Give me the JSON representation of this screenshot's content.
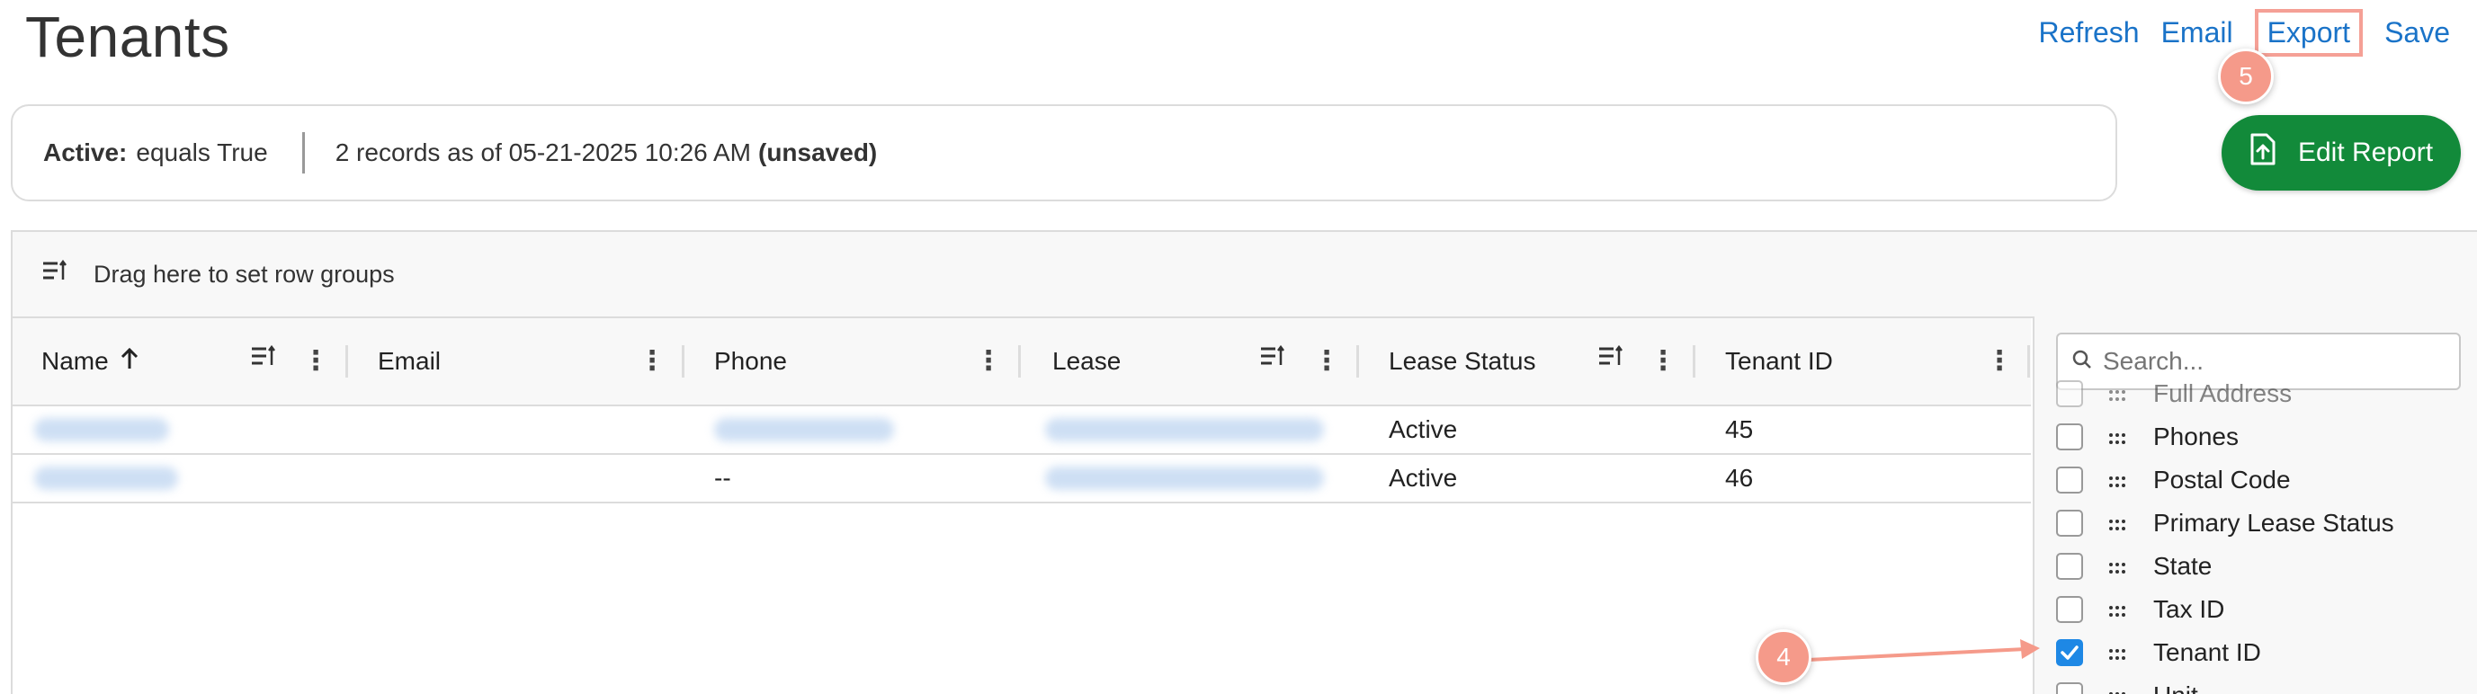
{
  "page": {
    "title": "Tenants"
  },
  "top_actions": {
    "refresh": "Refresh",
    "email": "Email",
    "export": "Export",
    "save": "Save"
  },
  "annotations": {
    "badge_export": "5",
    "badge_tenant_id": "4"
  },
  "filter": {
    "label": "Active:",
    "value": "equals True",
    "summary": "2 records as of 05-21-2025 10:26 AM",
    "status": "(unsaved)"
  },
  "edit_report": {
    "label": "Edit Report"
  },
  "group_bar": {
    "text": "Drag here to set row groups"
  },
  "columns": [
    {
      "label": "Name"
    },
    {
      "label": "Email"
    },
    {
      "label": "Phone"
    },
    {
      "label": "Lease"
    },
    {
      "label": "Lease Status"
    },
    {
      "label": "Tenant ID"
    }
  ],
  "rows": [
    {
      "phone": "",
      "lease_status": "Active",
      "tenant_id": "45"
    },
    {
      "phone": "--",
      "lease_status": "Active",
      "tenant_id": "46"
    }
  ],
  "column_panel": {
    "search_placeholder": "Search...",
    "items": [
      {
        "label": "Full Address",
        "checked": false
      },
      {
        "label": "Phones",
        "checked": false
      },
      {
        "label": "Postal Code",
        "checked": false
      },
      {
        "label": "Primary Lease Status",
        "checked": false
      },
      {
        "label": "State",
        "checked": false
      },
      {
        "label": "Tax ID",
        "checked": false
      },
      {
        "label": "Tenant ID",
        "checked": true
      },
      {
        "label": "Unit",
        "checked": false
      }
    ]
  },
  "colors": {
    "link": "#1a73c8",
    "primary_button": "#128a3a",
    "annotation": "#f59a8a",
    "checkbox_checked": "#1e88e5"
  }
}
